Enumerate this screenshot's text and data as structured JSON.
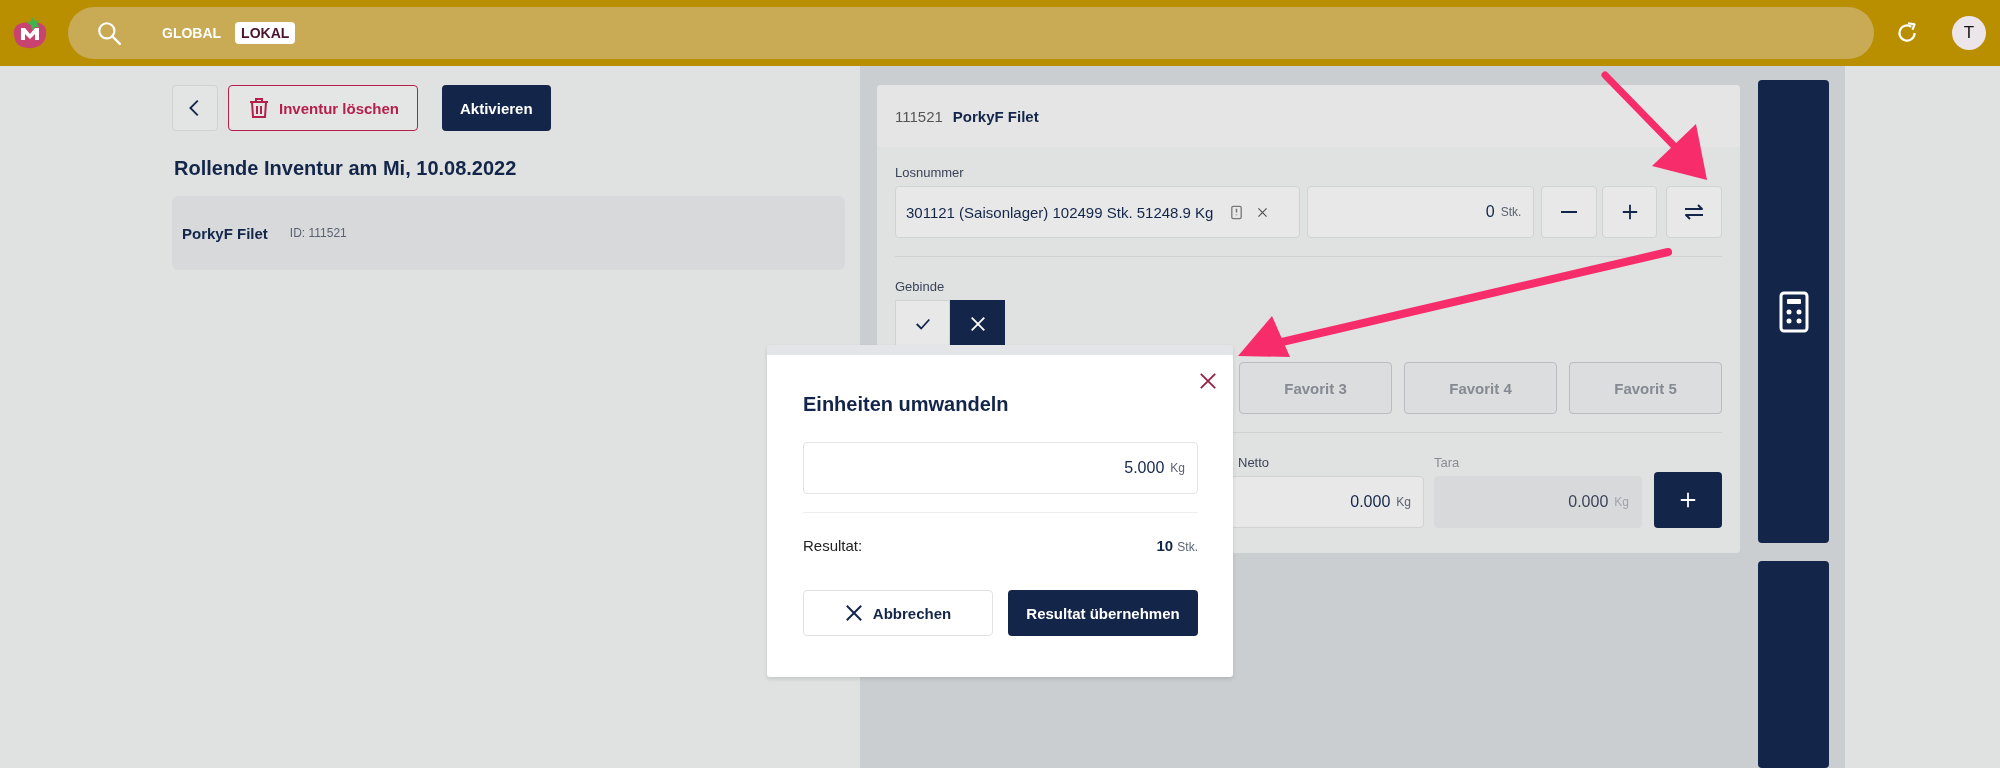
{
  "topbar": {
    "scopes": [
      {
        "label": "GLOBAL",
        "selected": false
      },
      {
        "label": "LOKAL",
        "selected": true
      }
    ],
    "avatar": "T"
  },
  "toolbar": {
    "delete_button": "Inventur löschen",
    "activate_button": "Aktivieren"
  },
  "title": "Rollende Inventur am Mi, 10.08.2022",
  "items": [
    {
      "name": "PorkyF Filet",
      "id": "ID: 111521"
    }
  ],
  "article": {
    "number": "111521",
    "name": "PorkyF Filet"
  },
  "lot": {
    "label": "Losnummer",
    "value": "301121 (Saisonlager) 102499 Stk. 51248.9 Kg"
  },
  "quantity": {
    "value": "0",
    "unit": "Stk."
  },
  "gebinde": {
    "label": "Gebinde",
    "options": [
      {
        "kind": "check",
        "selected": false
      },
      {
        "kind": "cross",
        "selected": true
      }
    ]
  },
  "favorites": [
    "Favorit 3",
    "Favorit 4",
    "Favorit 5"
  ],
  "weights": [
    {
      "label": "Netto",
      "value": "0.000",
      "unit": "Kg",
      "disabled": false
    },
    {
      "label": "Tara",
      "value": "0.000",
      "unit": "Kg",
      "disabled": true
    }
  ],
  "dialog": {
    "title": "Einheiten umwandeln",
    "input": {
      "value": "5.000",
      "unit": "Kg"
    },
    "result_label": "Resultat:",
    "result": {
      "value": "10",
      "unit": "Stk."
    },
    "cancel": "Abbrechen",
    "confirm": "Resultat übernehmen"
  }
}
